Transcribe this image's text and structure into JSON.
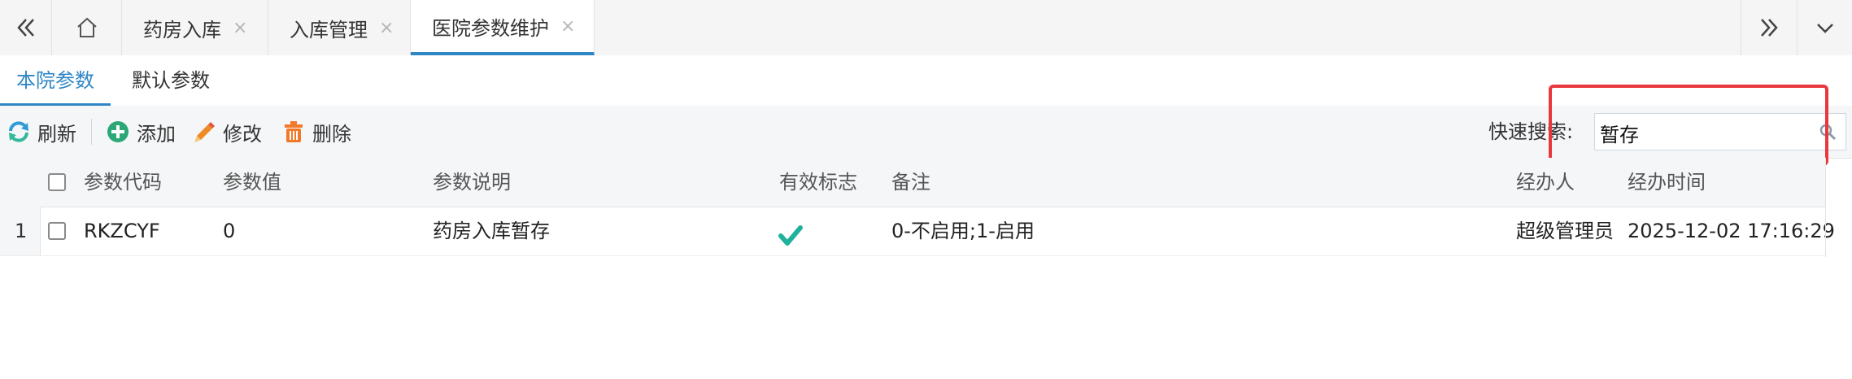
{
  "tabbar": {
    "tabs": [
      {
        "label": "药房入库"
      },
      {
        "label": "入库管理"
      },
      {
        "label": "医院参数维护"
      }
    ],
    "close_glyph": "×",
    "icons": [
      "double-chevron-left-icon",
      "home-icon",
      "double-chevron-right-icon",
      "chevron-down-icon"
    ]
  },
  "subtabs": [
    {
      "label": "本院参数",
      "active": true
    },
    {
      "label": "默认参数",
      "active": false
    }
  ],
  "toolbar": {
    "refresh_label": "刷新",
    "add_label": "添加",
    "edit_label": "修改",
    "delete_label": "删除",
    "search_label": "快速搜索:",
    "search_value": "暂存"
  },
  "grid": {
    "columns": [
      "参数代码",
      "参数值",
      "参数说明",
      "有效标志",
      "备注",
      "经办人",
      "经办时间"
    ],
    "rows": [
      {
        "index": "1",
        "code": "RKZCYF",
        "value": "0",
        "description": "药房入库暂存",
        "valid": true,
        "remark": "0-不启用;1-启用",
        "handler": "超级管理员",
        "time": "2025-12-02 17:16:29"
      }
    ]
  },
  "colors": {
    "accent": "#2f86c5",
    "highlight": "#e8383d",
    "check": "#1fb19b"
  }
}
